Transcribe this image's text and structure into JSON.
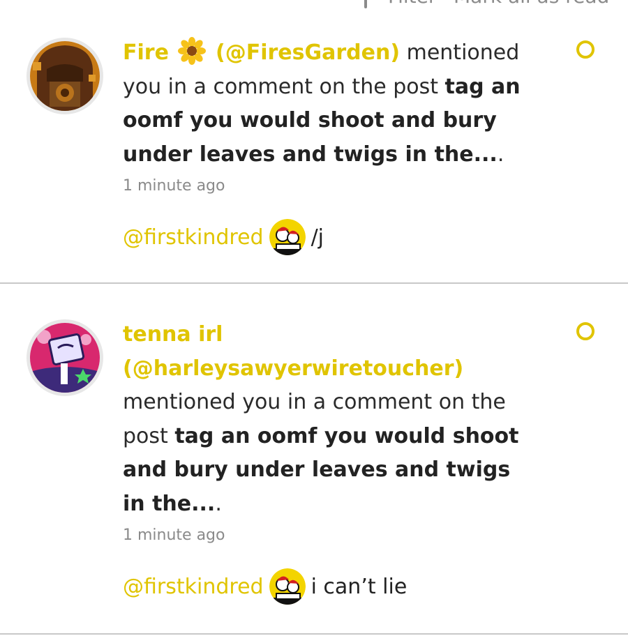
{
  "header": {
    "filter_label": "Filter",
    "mark_all_read_label": "Mark all as read"
  },
  "colors": {
    "accent": "#e0c400",
    "divider": "#c8c8c8",
    "muted_text": "#8a8a8a"
  },
  "notifications": [
    {
      "actor_name": "Fire",
      "actor_emoji_icon": "sunflower-icon",
      "actor_handle": "(@FiresGarden)",
      "action_text": "mentioned you in a comment on the post",
      "post_title": "tag an oomf you would shoot and bury under leaves and twigs in the...",
      "post_suffix": ".",
      "time": "1 minute ago",
      "reply_mention": "@firstkindred",
      "reply_text": "/j",
      "unread": true
    },
    {
      "actor_name": "tenna irl",
      "actor_handle": "(@harleysawyerwiretoucher)",
      "action_text": "mentioned you in a comment on the post",
      "post_title": "tag an oomf you would shoot and bury under leaves and twigs in the...",
      "post_suffix": ".",
      "time": "1 minute ago",
      "reply_mention": "@firstkindred",
      "reply_text": "i can’t lie",
      "unread": true
    }
  ]
}
